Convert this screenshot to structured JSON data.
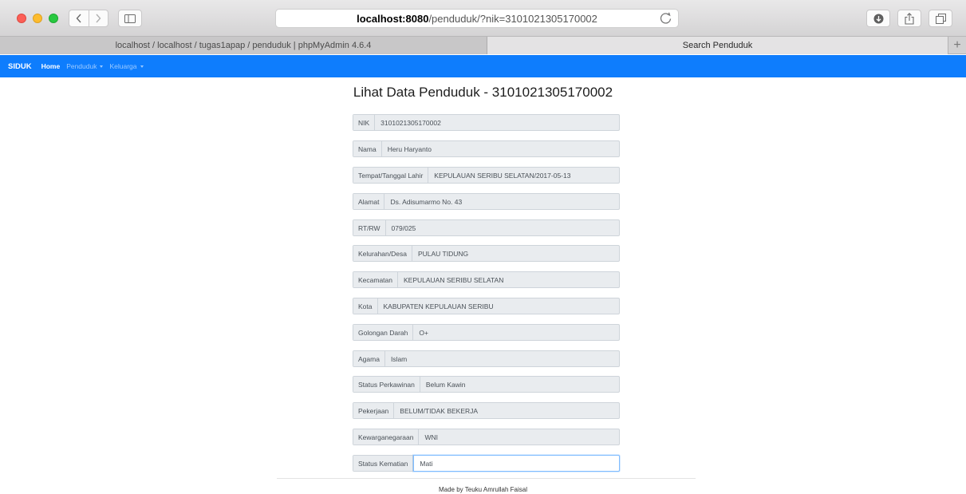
{
  "browser": {
    "url_host": "localhost:8080",
    "url_path": "/penduduk/?nik=3101021305170002",
    "tabs": [
      {
        "label": "localhost / localhost / tugas1apap / penduduk | phpMyAdmin 4.6.4"
      },
      {
        "label": "Search Penduduk"
      }
    ],
    "new_tab_label": "+"
  },
  "navbar": {
    "brand": "SIDUK",
    "items": [
      {
        "label": "Home"
      },
      {
        "label": "Penduduk"
      },
      {
        "label": "Keluarga"
      }
    ]
  },
  "page": {
    "title": "Lihat Data Penduduk - 3101021305170002",
    "fields": [
      {
        "label": "NIK",
        "value": "3101021305170002"
      },
      {
        "label": "Nama",
        "value": "Heru Haryanto"
      },
      {
        "label": "Tempat/Tanggal Lahir",
        "value": "KEPULAUAN SERIBU SELATAN/2017-05-13"
      },
      {
        "label": "Alamat",
        "value": "Ds. Adisumarmo No. 43"
      },
      {
        "label": "RT/RW",
        "value": "079/025"
      },
      {
        "label": "Kelurahan/Desa",
        "value": "PULAU TIDUNG"
      },
      {
        "label": "Kecamatan",
        "value": "KEPULAUAN SERIBU SELATAN"
      },
      {
        "label": "Kota",
        "value": "KABUPATEN KEPULAUAN SERIBU"
      },
      {
        "label": "Golongan Darah",
        "value": "O+"
      },
      {
        "label": "Agama",
        "value": "Islam"
      },
      {
        "label": "Status Perkawinan",
        "value": "Belum Kawin"
      },
      {
        "label": "Pekerjaan",
        "value": "BELUM/TIDAK BEKERJA"
      },
      {
        "label": "Kewarganegaraan",
        "value": "WNI"
      },
      {
        "label": "Status Kematian",
        "value": "Mati"
      }
    ]
  },
  "footer": {
    "text": "Made by Teuku Amrullah Faisal"
  },
  "colors": {
    "navbar": "#0e7dfd",
    "field_bg": "#e9ecef"
  }
}
